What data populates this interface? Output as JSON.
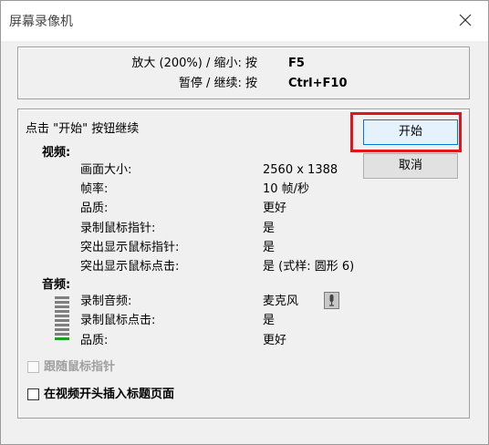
{
  "window": {
    "title": "屏幕录像机"
  },
  "hotkeys": {
    "zoom_label": "放大 (200%) / 缩小:  按",
    "zoom_key": "F5",
    "pause_label": "暂停 / 继续:  按",
    "pause_key": "Ctrl+F10"
  },
  "instruction": "点击 \"开始\" 按钮继续",
  "buttons": {
    "start": "开始",
    "cancel": "取消"
  },
  "video": {
    "heading": "视频:",
    "settings": [
      {
        "label": "画面大小:",
        "value": "2560 x 1388"
      },
      {
        "label": "帧率:",
        "value": "10 帧/秒"
      },
      {
        "label": "品质:",
        "value": "更好"
      },
      {
        "label": "录制鼠标指针:",
        "value": "是"
      },
      {
        "label": "突出显示鼠标指针:",
        "value": "是"
      },
      {
        "label": "突出显示鼠标点击:",
        "value": "是 (式样:  圆形 6)"
      }
    ]
  },
  "audio": {
    "heading": "音频:",
    "meter_level": 0.1,
    "meter_color": "#1e9e1e",
    "settings": [
      {
        "label": "录制音频:",
        "value": "麦克风"
      },
      {
        "label": "录制鼠标点击:",
        "value": "是"
      },
      {
        "label": "品质:",
        "value": "更好"
      }
    ]
  },
  "options": {
    "follow_pointer": {
      "label": "跟随鼠标指针",
      "checked": false,
      "enabled": false
    },
    "insert_title": {
      "label": "在视频开头插入标题页面",
      "checked": false,
      "enabled": true
    }
  },
  "icons": {
    "close": "close-icon",
    "microphone": "microphone-icon"
  },
  "colors": {
    "highlight": "#e0161e",
    "start_border": "#0078d7"
  }
}
